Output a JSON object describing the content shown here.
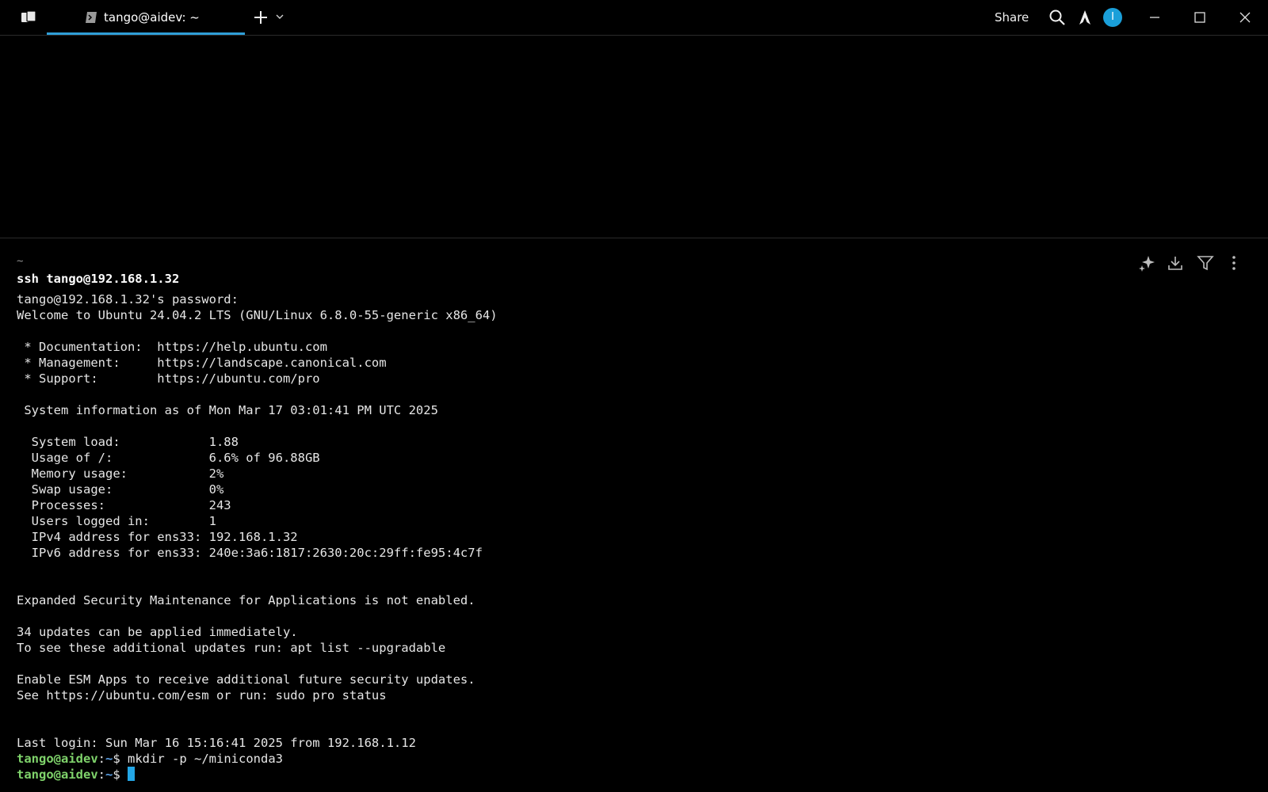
{
  "titlebar": {
    "tab_title": "tango@aidev: ~",
    "share_label": "Share",
    "avatar_letter": "I"
  },
  "terminal": {
    "cwd": "~",
    "command": "ssh tango@192.168.1.32",
    "output": [
      "tango@192.168.1.32's password:",
      "Welcome to Ubuntu 24.04.2 LTS (GNU/Linux 6.8.0-55-generic x86_64)",
      "",
      " * Documentation:  https://help.ubuntu.com",
      " * Management:     https://landscape.canonical.com",
      " * Support:        https://ubuntu.com/pro",
      "",
      " System information as of Mon Mar 17 03:01:41 PM UTC 2025",
      "",
      "  System load:            1.88",
      "  Usage of /:             6.6% of 96.88GB",
      "  Memory usage:           2%",
      "  Swap usage:             0%",
      "  Processes:              243",
      "  Users logged in:        1",
      "  IPv4 address for ens33: 192.168.1.32",
      "  IPv6 address for ens33: 240e:3a6:1817:2630:20c:29ff:fe95:4c7f",
      "",
      "",
      "Expanded Security Maintenance for Applications is not enabled.",
      "",
      "34 updates can be applied immediately.",
      "To see these additional updates run: apt list --upgradable",
      "",
      "Enable ESM Apps to receive additional future security updates.",
      "See https://ubuntu.com/esm or run: sudo pro status",
      "",
      "",
      "Last login: Sun Mar 16 15:16:41 2025 from 192.168.1.12"
    ],
    "prompt_user": "tango@aidev",
    "prompt_sep": ":",
    "prompt_path": "~",
    "prompt_dollar": "$ ",
    "last_command": "mkdir -p ~/miniconda3",
    "current_input": ""
  },
  "icons": {
    "app": "warp-logo-icon",
    "tab": "terminal-prompt-icon",
    "new_tab": "plus-icon",
    "tab_menu": "chevron-down-icon",
    "search": "search-icon",
    "ai": "warp-ai-icon",
    "minimize": "minimize-icon",
    "maximize": "maximize-icon",
    "close": "close-icon",
    "block_ai": "sparkle-icon",
    "block_save": "download-icon",
    "block_filter": "filter-icon",
    "block_more": "more-vertical-icon"
  },
  "colors": {
    "accent": "#2f9fd8",
    "prompt_user": "#7fd36b",
    "prompt_path": "#5aa0e6",
    "background": "#000000"
  }
}
